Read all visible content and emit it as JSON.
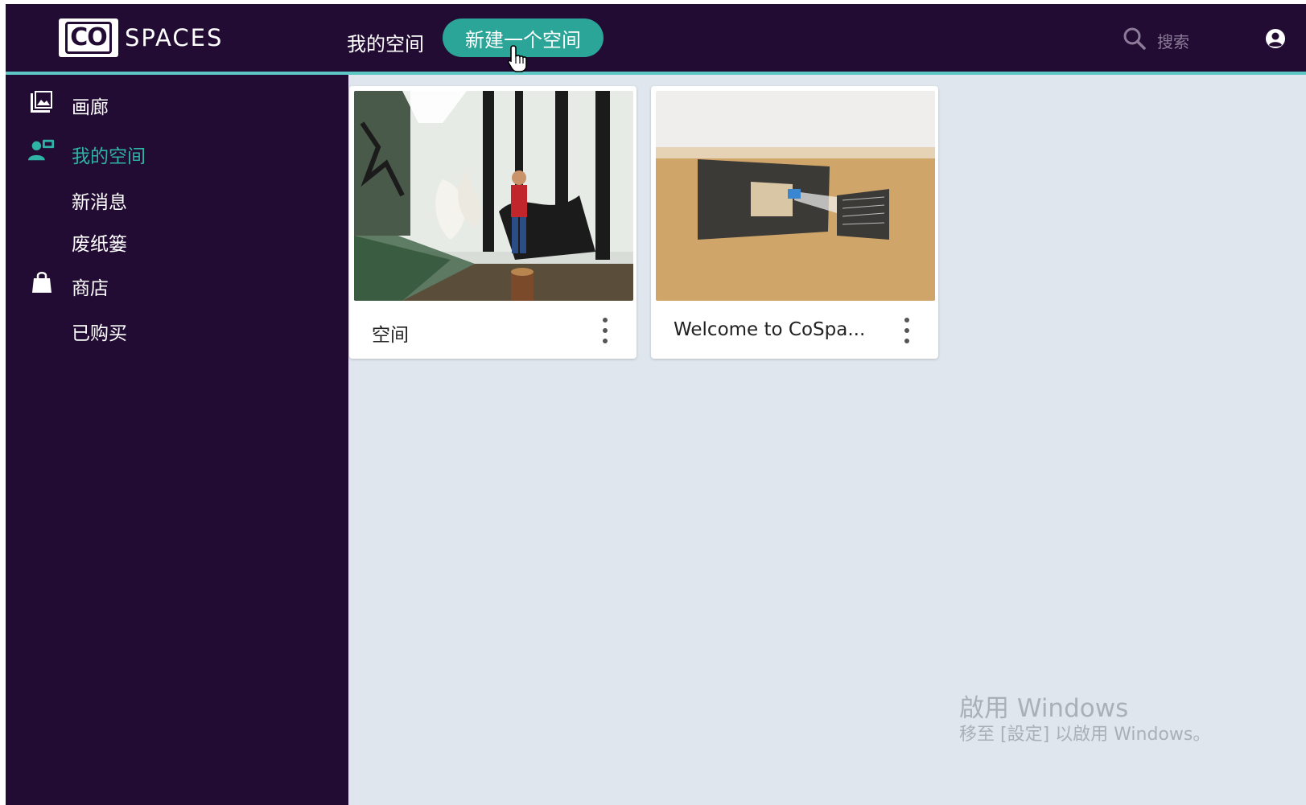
{
  "brand": {
    "logo_mark": "CO",
    "logo_text": "SPACES"
  },
  "topnav": {
    "my_spaces": "我的空间",
    "new_space": "新建一个空间",
    "search_label": "搜索"
  },
  "sidebar": {
    "items": [
      {
        "label": "画廊",
        "icon": "gallery-icon"
      },
      {
        "label": "我的空间",
        "icon": "my-spaces-icon",
        "active": true
      },
      {
        "label": "新消息"
      },
      {
        "label": "废纸篓"
      },
      {
        "label": "商店",
        "icon": "shopping-bag-icon"
      },
      {
        "label": "已购买"
      }
    ]
  },
  "cards": [
    {
      "title": "空间"
    },
    {
      "title": "Welcome to CoSpa..."
    }
  ],
  "watermark": {
    "line1": "啟用 Windows",
    "line2": "移至 [設定] 以啟用 Windows。"
  },
  "colors": {
    "topbar": "#220c33",
    "accent": "#2aa597",
    "active_text": "#2fb3a5",
    "content_bg": "#dfe6ed",
    "underline": "#5ec6c4"
  }
}
